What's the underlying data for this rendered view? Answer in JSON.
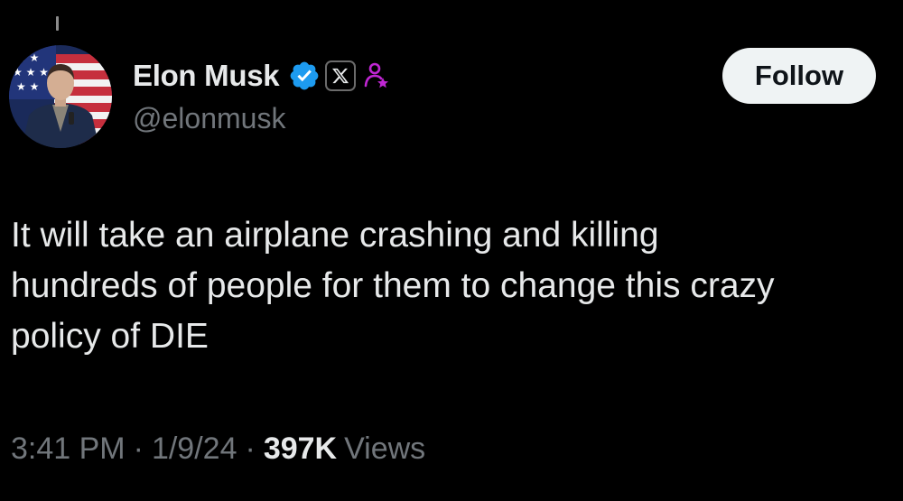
{
  "colors": {
    "background": "#000000",
    "primary_text": "#e7e9ea",
    "secondary_text": "#71767b",
    "verified_blue": "#1d9bf0",
    "follow_button_bg": "#eff3f4",
    "affiliate_pink": "#c026d3"
  },
  "header": {
    "display_name": "Elon Musk",
    "handle": "@elonmusk",
    "follow_label": "Follow",
    "icons": [
      "verified-icon",
      "x-affiliate-icon",
      "person-star-icon"
    ]
  },
  "tweet": {
    "text": "It will take an airplane crashing and killing\nhundreds of people for them to change this crazy\npolicy of DIE"
  },
  "meta": {
    "time": "3:41 PM",
    "separator": "·",
    "date": "1/9/24",
    "views_count": "397K",
    "views_label": "Views"
  }
}
